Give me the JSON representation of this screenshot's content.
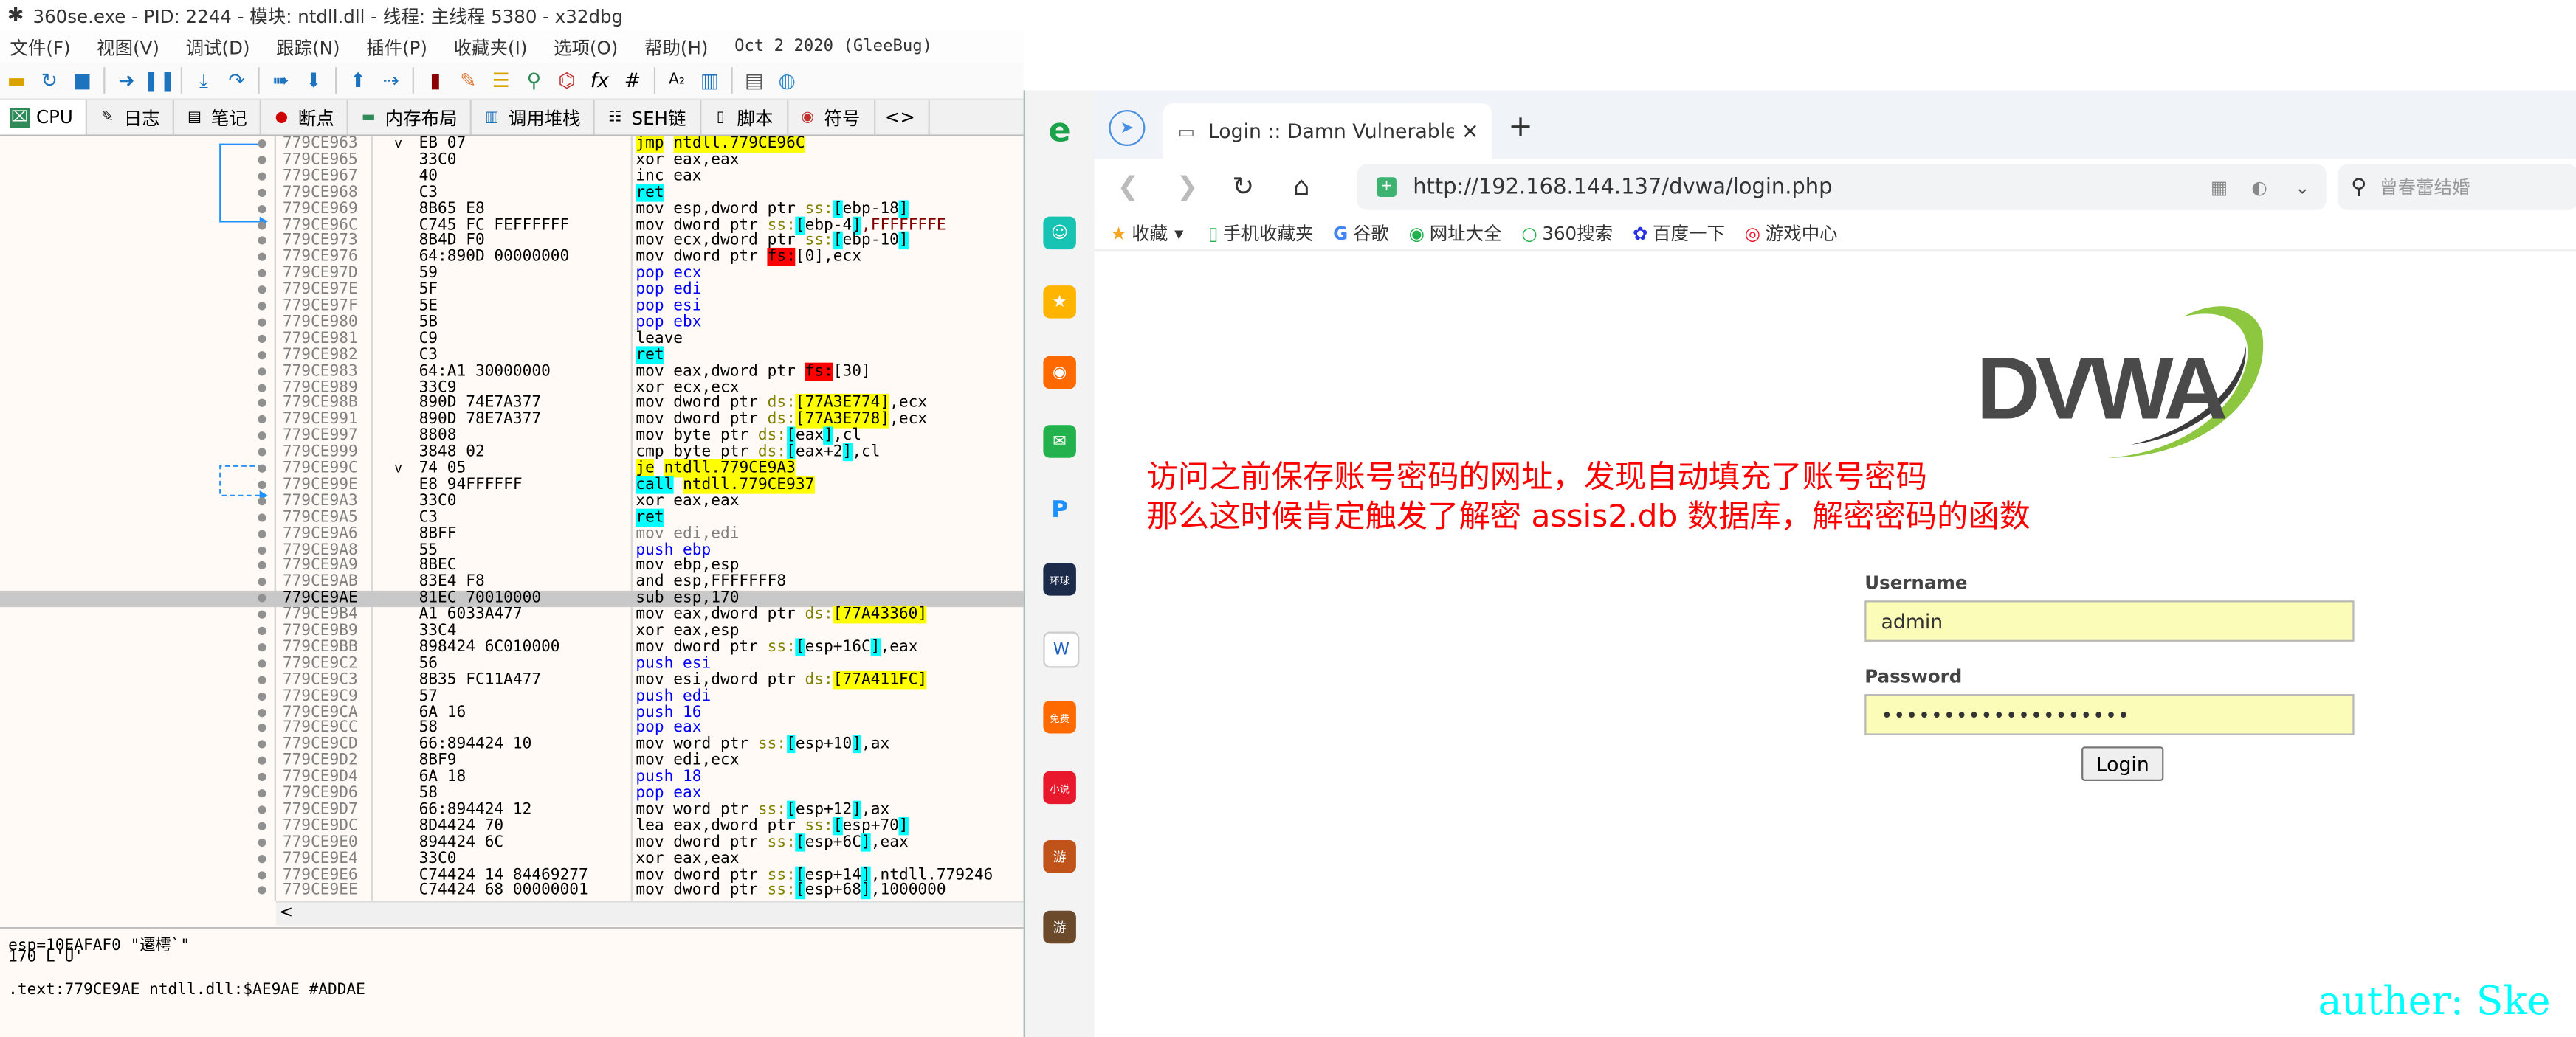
{
  "debugger": {
    "title": "360se.exe - PID: 2244 - 模块: ntdll.dll - 线程: 主线程 5380 - x32dbg",
    "menu": [
      "文件(F)",
      "视图(V)",
      "调试(D)",
      "跟踪(N)",
      "插件(P)",
      "收藏夹(I)",
      "选项(O)",
      "帮助(H)",
      "Oct 2 2020 (GleeBug)"
    ],
    "tabs": [
      "CPU",
      "日志",
      "笔记",
      "断点",
      "内存布局",
      "调用堆栈",
      "SEH链",
      "脚本",
      "符号",
      "<>"
    ],
    "rows": [
      {
        "addr": "779CE963",
        "arr": "v",
        "bytes": "EB 07",
        "ins": [
          {
            "t": "jmp",
            "c": "c-jmp"
          },
          {
            "t": " "
          },
          {
            "t": "ntdll.779CE96C",
            "c": "hl-y"
          }
        ]
      },
      {
        "addr": "779CE965",
        "bytes": "33C0",
        "ins": [
          {
            "t": "xor eax,eax"
          }
        ]
      },
      {
        "addr": "779CE967",
        "bytes": "40",
        "ins": [
          {
            "t": "inc eax"
          }
        ]
      },
      {
        "addr": "779CE968",
        "bytes": "C3",
        "ins": [
          {
            "t": "ret",
            "c": "c-ret"
          }
        ]
      },
      {
        "addr": "779CE969",
        "bytes": "8B65 E8",
        "ins": [
          {
            "t": "mov esp,dword ptr "
          },
          {
            "t": "ss:",
            "c": "c-seg"
          },
          {
            "t": "[",
            "c": "hl-c"
          },
          {
            "t": "ebp-18"
          },
          {
            "t": "]",
            "c": "hl-c"
          }
        ]
      },
      {
        "addr": "779CE96C",
        "bytes": "C745 FC FEFFFFFF",
        "ins": [
          {
            "t": "mov dword ptr "
          },
          {
            "t": "ss:",
            "c": "c-seg"
          },
          {
            "t": "[",
            "c": "hl-c"
          },
          {
            "t": "ebp-4"
          },
          {
            "t": "]",
            "c": "hl-c"
          },
          {
            "t": ",FFFFFFFE",
            "c": "c-num"
          }
        ]
      },
      {
        "addr": "779CE973",
        "bytes": "8B4D F0",
        "ins": [
          {
            "t": "mov ecx,dword ptr "
          },
          {
            "t": "ss:",
            "c": "c-seg"
          },
          {
            "t": "[",
            "c": "hl-c"
          },
          {
            "t": "ebp-10"
          },
          {
            "t": "]",
            "c": "hl-c"
          }
        ]
      },
      {
        "addr": "779CE976",
        "bytes": "64:890D 00000000",
        "ins": [
          {
            "t": "mov dword ptr "
          },
          {
            "t": "fs:",
            "c": "hl-r"
          },
          {
            "t": "[0],ecx"
          }
        ]
      },
      {
        "addr": "779CE97D",
        "bytes": "59",
        "ins": [
          {
            "t": "pop ecx",
            "c": "c-pop"
          }
        ]
      },
      {
        "addr": "779CE97E",
        "bytes": "5F",
        "ins": [
          {
            "t": "pop edi",
            "c": "c-pop"
          }
        ]
      },
      {
        "addr": "779CE97F",
        "bytes": "5E",
        "ins": [
          {
            "t": "pop esi",
            "c": "c-pop"
          }
        ]
      },
      {
        "addr": "779CE980",
        "bytes": "5B",
        "ins": [
          {
            "t": "pop ebx",
            "c": "c-pop"
          }
        ]
      },
      {
        "addr": "779CE981",
        "bytes": "C9",
        "ins": [
          {
            "t": "leave"
          }
        ]
      },
      {
        "addr": "779CE982",
        "bytes": "C3",
        "ins": [
          {
            "t": "ret",
            "c": "c-ret"
          }
        ]
      },
      {
        "addr": "779CE983",
        "bytes": "64:A1 30000000",
        "ins": [
          {
            "t": "mov eax,dword ptr "
          },
          {
            "t": "fs:",
            "c": "hl-r"
          },
          {
            "t": "[30]"
          }
        ]
      },
      {
        "addr": "779CE989",
        "bytes": "33C9",
        "ins": [
          {
            "t": "xor ecx,ecx"
          }
        ]
      },
      {
        "addr": "779CE98B",
        "bytes": "890D 74E7A377",
        "ins": [
          {
            "t": "mov dword ptr "
          },
          {
            "t": "ds:",
            "c": "c-seg"
          },
          {
            "t": "[77A3E774]",
            "c": "hl-y"
          },
          {
            "t": ",ecx"
          }
        ]
      },
      {
        "addr": "779CE991",
        "bytes": "890D 78E7A377",
        "ins": [
          {
            "t": "mov dword ptr "
          },
          {
            "t": "ds:",
            "c": "c-seg"
          },
          {
            "t": "[77A3E778]",
            "c": "hl-y"
          },
          {
            "t": ",ecx"
          }
        ]
      },
      {
        "addr": "779CE997",
        "bytes": "8808",
        "ins": [
          {
            "t": "mov byte ptr "
          },
          {
            "t": "ds:",
            "c": "c-seg"
          },
          {
            "t": "[",
            "c": "hl-c"
          },
          {
            "t": "eax"
          },
          {
            "t": "]",
            "c": "hl-c"
          },
          {
            "t": ",cl"
          }
        ]
      },
      {
        "addr": "779CE999",
        "bytes": "3848 02",
        "ins": [
          {
            "t": "cmp byte ptr "
          },
          {
            "t": "ds:",
            "c": "c-seg"
          },
          {
            "t": "[",
            "c": "hl-c"
          },
          {
            "t": "eax+2"
          },
          {
            "t": "]",
            "c": "hl-c"
          },
          {
            "t": ",cl"
          }
        ]
      },
      {
        "addr": "779CE99C",
        "arr": "v",
        "bytes": "74 05",
        "ins": [
          {
            "t": "je",
            "c": "c-jmp"
          },
          {
            "t": " "
          },
          {
            "t": "ntdll.779CE9A3",
            "c": "hl-y"
          }
        ]
      },
      {
        "addr": "779CE99E",
        "bytes": "E8 94FFFFFF",
        "ins": [
          {
            "t": "call",
            "c": "c-call"
          },
          {
            "t": " "
          },
          {
            "t": "ntdll.779CE937",
            "c": "hl-y"
          }
        ]
      },
      {
        "addr": "779CE9A3",
        "bytes": "33C0",
        "ins": [
          {
            "t": "xor eax,eax"
          }
        ]
      },
      {
        "addr": "779CE9A5",
        "bytes": "C3",
        "ins": [
          {
            "t": "ret",
            "c": "c-ret"
          }
        ]
      },
      {
        "addr": "779CE9A6",
        "bytes": "8BFF",
        "ins": [
          {
            "t": "mov edi,edi",
            "c": "c-grey"
          }
        ]
      },
      {
        "addr": "779CE9A8",
        "bytes": "55",
        "ins": [
          {
            "t": "push ebp",
            "c": "c-push"
          }
        ]
      },
      {
        "addr": "779CE9A9",
        "bytes": "8BEC",
        "ins": [
          {
            "t": "mov ebp,esp"
          }
        ]
      },
      {
        "addr": "779CE9AB",
        "bytes": "83E4 F8",
        "ins": [
          {
            "t": "and esp,FFFFFFF8"
          }
        ]
      },
      {
        "addr": "779CE9AE",
        "bytes": "81EC 70010000",
        "sel": true,
        "ins": [
          {
            "t": "sub esp,170"
          }
        ]
      },
      {
        "addr": "779CE9B4",
        "bytes": "A1 6033A477",
        "ins": [
          {
            "t": "mov eax,dword ptr "
          },
          {
            "t": "ds:",
            "c": "c-seg"
          },
          {
            "t": "[77A43360]",
            "c": "hl-y"
          }
        ]
      },
      {
        "addr": "779CE9B9",
        "bytes": "33C4",
        "ins": [
          {
            "t": "xor eax,esp"
          }
        ]
      },
      {
        "addr": "779CE9BB",
        "bytes": "898424 6C010000",
        "ins": [
          {
            "t": "mov dword ptr "
          },
          {
            "t": "ss:",
            "c": "c-seg"
          },
          {
            "t": "[",
            "c": "hl-c"
          },
          {
            "t": "esp+16C"
          },
          {
            "t": "]",
            "c": "hl-c"
          },
          {
            "t": ",eax"
          }
        ]
      },
      {
        "addr": "779CE9C2",
        "bytes": "56",
        "ins": [
          {
            "t": "push esi",
            "c": "c-push"
          }
        ]
      },
      {
        "addr": "779CE9C3",
        "bytes": "8B35 FC11A477",
        "ins": [
          {
            "t": "mov esi,dword ptr "
          },
          {
            "t": "ds:",
            "c": "c-seg"
          },
          {
            "t": "[77A411FC]",
            "c": "hl-y"
          }
        ]
      },
      {
        "addr": "779CE9C9",
        "bytes": "57",
        "ins": [
          {
            "t": "push edi",
            "c": "c-push"
          }
        ]
      },
      {
        "addr": "779CE9CA",
        "bytes": "6A 16",
        "ins": [
          {
            "t": "push 16",
            "c": "c-push"
          }
        ]
      },
      {
        "addr": "779CE9CC",
        "bytes": "58",
        "ins": [
          {
            "t": "pop eax",
            "c": "c-pop"
          }
        ]
      },
      {
        "addr": "779CE9CD",
        "bytes": "66:894424 10",
        "ins": [
          {
            "t": "mov word ptr "
          },
          {
            "t": "ss:",
            "c": "c-seg"
          },
          {
            "t": "[",
            "c": "hl-c"
          },
          {
            "t": "esp+10"
          },
          {
            "t": "]",
            "c": "hl-c"
          },
          {
            "t": ",ax"
          }
        ]
      },
      {
        "addr": "779CE9D2",
        "bytes": "8BF9",
        "ins": [
          {
            "t": "mov edi,ecx"
          }
        ]
      },
      {
        "addr": "779CE9D4",
        "bytes": "6A 18",
        "ins": [
          {
            "t": "push 18",
            "c": "c-push"
          }
        ]
      },
      {
        "addr": "779CE9D6",
        "bytes": "58",
        "ins": [
          {
            "t": "pop eax",
            "c": "c-pop"
          }
        ]
      },
      {
        "addr": "779CE9D7",
        "bytes": "66:894424 12",
        "ins": [
          {
            "t": "mov word ptr "
          },
          {
            "t": "ss:",
            "c": "c-seg"
          },
          {
            "t": "[",
            "c": "hl-c"
          },
          {
            "t": "esp+12"
          },
          {
            "t": "]",
            "c": "hl-c"
          },
          {
            "t": ",ax"
          }
        ]
      },
      {
        "addr": "779CE9DC",
        "bytes": "8D4424 70",
        "ins": [
          {
            "t": "lea eax,dword ptr "
          },
          {
            "t": "ss:",
            "c": "c-seg"
          },
          {
            "t": "[",
            "c": "hl-c"
          },
          {
            "t": "esp+70"
          },
          {
            "t": "]",
            "c": "hl-c"
          }
        ]
      },
      {
        "addr": "779CE9E0",
        "bytes": "894424 6C",
        "ins": [
          {
            "t": "mov dword ptr "
          },
          {
            "t": "ss:",
            "c": "c-seg"
          },
          {
            "t": "[",
            "c": "hl-c"
          },
          {
            "t": "esp+6C"
          },
          {
            "t": "]",
            "c": "hl-c"
          },
          {
            "t": ",eax"
          }
        ]
      },
      {
        "addr": "779CE9E4",
        "bytes": "33C0",
        "ins": [
          {
            "t": "xor eax,eax"
          }
        ]
      },
      {
        "addr": "779CE9E6",
        "bytes": "C74424 14 84469277",
        "ins": [
          {
            "t": "mov dword ptr "
          },
          {
            "t": "ss:",
            "c": "c-seg"
          },
          {
            "t": "[",
            "c": "hl-c"
          },
          {
            "t": "esp+14"
          },
          {
            "t": "]",
            "c": "hl-c"
          },
          {
            "t": ",ntdll.779246"
          }
        ]
      },
      {
        "addr": "779CE9EE",
        "bytes": "C74424 68 00000001",
        "ins": [
          {
            "t": "mov dword ptr "
          },
          {
            "t": "ss:",
            "c": "c-seg"
          },
          {
            "t": "[",
            "c": "hl-c"
          },
          {
            "t": "esp+68"
          },
          {
            "t": "]",
            "c": "hl-c"
          },
          {
            "t": ",1000000"
          }
        ]
      }
    ],
    "info": [
      "esp=10EAFAF0 \"遷樗`\"",
      "170 L'Ű'",
      "",
      ".text:779CE9AE ntdll.dll:$AE9AE #ADDAE"
    ],
    "scroll_left": "<"
  },
  "browser": {
    "tab_title": "Login :: Damn Vulnerable We",
    "close": "×",
    "new_tab": "+",
    "url": "http://192.168.144.137/dvwa/login.php",
    "search_placeholder": "曾春蕾结婚",
    "bookmarks": [
      {
        "icon": "★",
        "label": "收藏"
      },
      {
        "icon": "▾",
        "label": ""
      },
      {
        "icon": "▯",
        "label": "手机收藏夹"
      },
      {
        "icon": "G",
        "label": "谷歌"
      },
      {
        "icon": "◉",
        "label": "网址大全"
      },
      {
        "icon": "○",
        "label": "360搜索"
      },
      {
        "icon": "✿",
        "label": "百度一下"
      },
      {
        "icon": "◎",
        "label": "游戏中心"
      }
    ],
    "sidebar": [
      "e",
      "☺",
      "★",
      "◉",
      "✉",
      "P",
      "环球",
      "W",
      "免费",
      "小说",
      "游",
      "游"
    ],
    "logo_text": "DVWA",
    "annotation": [
      "访问之前保存账号密码的网址，发现自动填充了账号密码",
      "那么这时候肯定触发了解密 assis2.db 数据库，解密密码的函数"
    ],
    "form": {
      "username_label": "Username",
      "username_value": "admin",
      "password_label": "Password",
      "password_value": "••••••••••••••••••••",
      "login_label": "Login"
    }
  },
  "author": "auther: Ske"
}
